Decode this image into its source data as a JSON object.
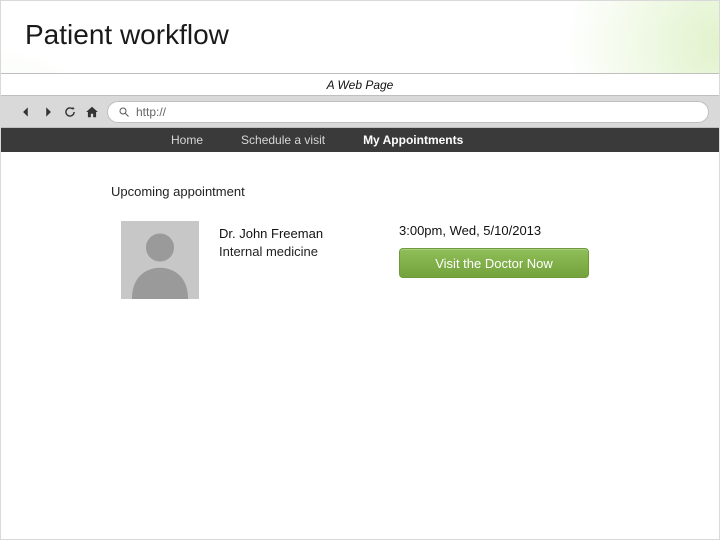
{
  "slide": {
    "title": "Patient workflow"
  },
  "browser": {
    "window_title": "A Web Page",
    "address": "http://"
  },
  "nav": {
    "items": [
      {
        "label": "Home"
      },
      {
        "label": "Schedule a visit"
      },
      {
        "label": "My Appointments"
      }
    ]
  },
  "section": {
    "heading": "Upcoming appointment"
  },
  "appointment": {
    "doctor_name": "Dr. John Freeman",
    "doctor_specialty": "Internal medicine",
    "time": "3:00pm, Wed, 5/10/2013",
    "visit_button": "Visit the Doctor Now"
  },
  "colors": {
    "accent": "#80b34d"
  }
}
